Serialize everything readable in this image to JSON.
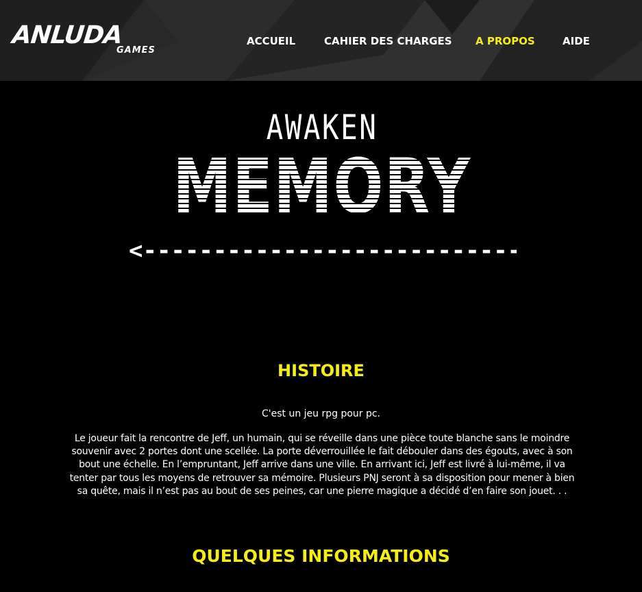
{
  "brand": {
    "name": "ANLUDA",
    "subtitle": "GAMES"
  },
  "nav": {
    "items": [
      {
        "label": "ACCUEIL",
        "active": false
      },
      {
        "label": "CAHIER DES CHARGES",
        "active": false
      },
      {
        "label": "A PROPOS",
        "active": true
      },
      {
        "label": "AIDE",
        "active": false
      }
    ]
  },
  "game_logo": {
    "line1": "AWAKEN",
    "line2": "MEMORY",
    "arrow": "<---------------------------->"
  },
  "sections": {
    "histoire": {
      "title": "HISTOIRE",
      "intro": "C'est un jeu rpg pour pc.",
      "text": "Le joueur fait la rencontre de Jeff, un humain, qui se réveille dans une pièce toute blanche sans le moindre souvenir avec 2 portes dont une scellée. La porte déverrouillée le fait débouler dans des égouts, avec à son bout une échelle. En l’empruntant, Jeff arrive dans une ville. En arrivant ici, Jeff est livré à lui-même, il va tenter par tous les moyens de retrouver sa mémoire. Plusieurs PNJ seront à sa disposition pour mener à bien sa quête, mais il n’est pas au bout de ses peines, car une pierre magique a décidé d’en faire son jouet. . ."
    },
    "informations": {
      "title": "QUELQUES INFORMATIONS"
    }
  },
  "colors": {
    "accent": "#f5ee16",
    "header_bg": "#262626",
    "page_bg": "#000000"
  }
}
